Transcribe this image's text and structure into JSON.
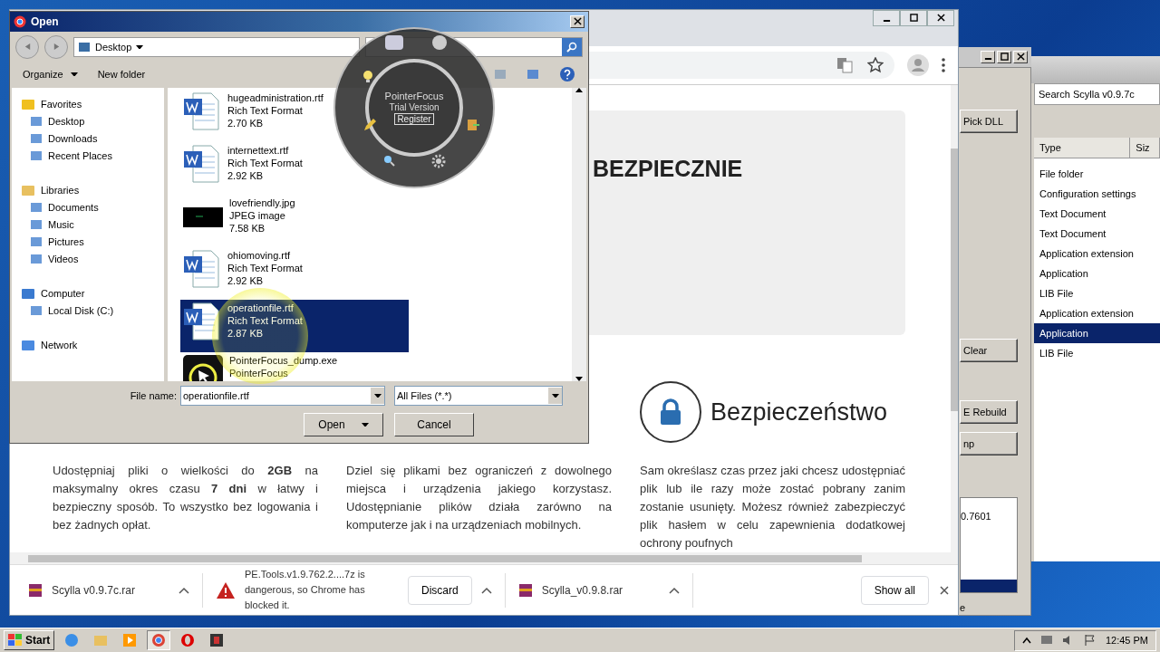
{
  "open_dialog": {
    "title": "Open",
    "location": "Desktop",
    "toolbar": [
      "Organize",
      "New folder"
    ],
    "nav": [
      {
        "label": "Favorites",
        "children": [
          {
            "label": "Desktop"
          },
          {
            "label": "Downloads"
          },
          {
            "label": "Recent Places"
          }
        ]
      },
      {
        "label": "Libraries",
        "children": [
          {
            "label": "Documents"
          },
          {
            "label": "Music"
          },
          {
            "label": "Pictures"
          },
          {
            "label": "Videos"
          }
        ]
      },
      {
        "label": "Computer",
        "children": [
          {
            "label": "Local Disk (C:)"
          }
        ]
      },
      {
        "label": "Network"
      }
    ],
    "files": [
      {
        "kind": "doc",
        "name": "hugeadministration.rtf",
        "type": "Rich Text Format",
        "size": "2.70 KB",
        "selected": false
      },
      {
        "kind": "doc",
        "name": "internettext.rtf",
        "type": "Rich Text Format",
        "size": "2.92 KB",
        "selected": false
      },
      {
        "kind": "image",
        "name": "lovefriendly.jpg",
        "type": "JPEG image",
        "size": "7.58 KB",
        "selected": false
      },
      {
        "kind": "doc",
        "name": "ohiomoving.rtf",
        "type": "Rich Text Format",
        "size": "2.92 KB",
        "selected": false
      },
      {
        "kind": "doc",
        "name": "operationfile.rtf",
        "type": "Rich Text Format",
        "size": "2.87 KB",
        "selected": true
      },
      {
        "kind": "exe",
        "name": "PointerFocus_dump.exe",
        "type": "PointerFocus",
        "selected": false
      }
    ],
    "file_name_label": "File name:",
    "file_name": "operationfile.rtf",
    "filter": "All Files (*.*)",
    "buttons": [
      "Open",
      "Cancel"
    ]
  },
  "pointer_focus": {
    "title": "PointerFocus",
    "subtitle": "Trial Version",
    "register": "Register"
  },
  "browser": {
    "heading": "BEZPIECZNIE",
    "feature_title": "Bezpieczeństwo",
    "paragraphs": [
      "Udostępniaj pliki o wielkości do **2GB** na maksymalny okres czasu **7 dni** w łatwy i bezpieczny sposób. To wszystko bez logowania i bez żadnych opłat.",
      "Dziel się plikami bez ograniczeń z dowolnego miejsca i urządzenia jakiego korzystasz. Udostępnianie plików działa zarówno na komputerze jak i na urządzeniach mobilnych.",
      "Sam określasz czas przez jaki chcesz udostępniać plik lub ile razy może zostać pobrany zanim zostanie usunięty. Możesz również zabezpieczyć plik hasłem w celu zapewnienia dodatkowej ochrony poufnych"
    ],
    "downloads": [
      {
        "kind": "file",
        "name": "Scylla v0.9.7c.rar"
      },
      {
        "kind": "blocked",
        "name": "PE.Tools.v1.9.762.2....7z is dangerous, so Chrome has blocked it.",
        "action": "Discard"
      },
      {
        "kind": "file",
        "name": "Scylla_v0.9.8.rar"
      }
    ],
    "show_all": "Show all"
  },
  "scylla": {
    "buttons": [
      "Pick DLL",
      "Clear",
      "E Rebuild",
      "np"
    ],
    "log": "0.7601",
    "status": "e"
  },
  "explorer": {
    "search": "Search Scylla v0.9.7c",
    "columns": [
      "Type",
      "Siz"
    ],
    "rows": [
      {
        "type": "File folder",
        "selected": false
      },
      {
        "type": "Configuration settings",
        "selected": false
      },
      {
        "type": "Text Document",
        "selected": false
      },
      {
        "type": "Text Document",
        "selected": false
      },
      {
        "type": "Application extension",
        "selected": false
      },
      {
        "type": "Application",
        "selected": false
      },
      {
        "type": "LIB File",
        "selected": false
      },
      {
        "type": "Application extension",
        "selected": false
      },
      {
        "type": "Application",
        "selected": true
      },
      {
        "type": "LIB File",
        "selected": false
      }
    ]
  },
  "taskbar": {
    "start": "Start",
    "time": "12:45 PM"
  }
}
